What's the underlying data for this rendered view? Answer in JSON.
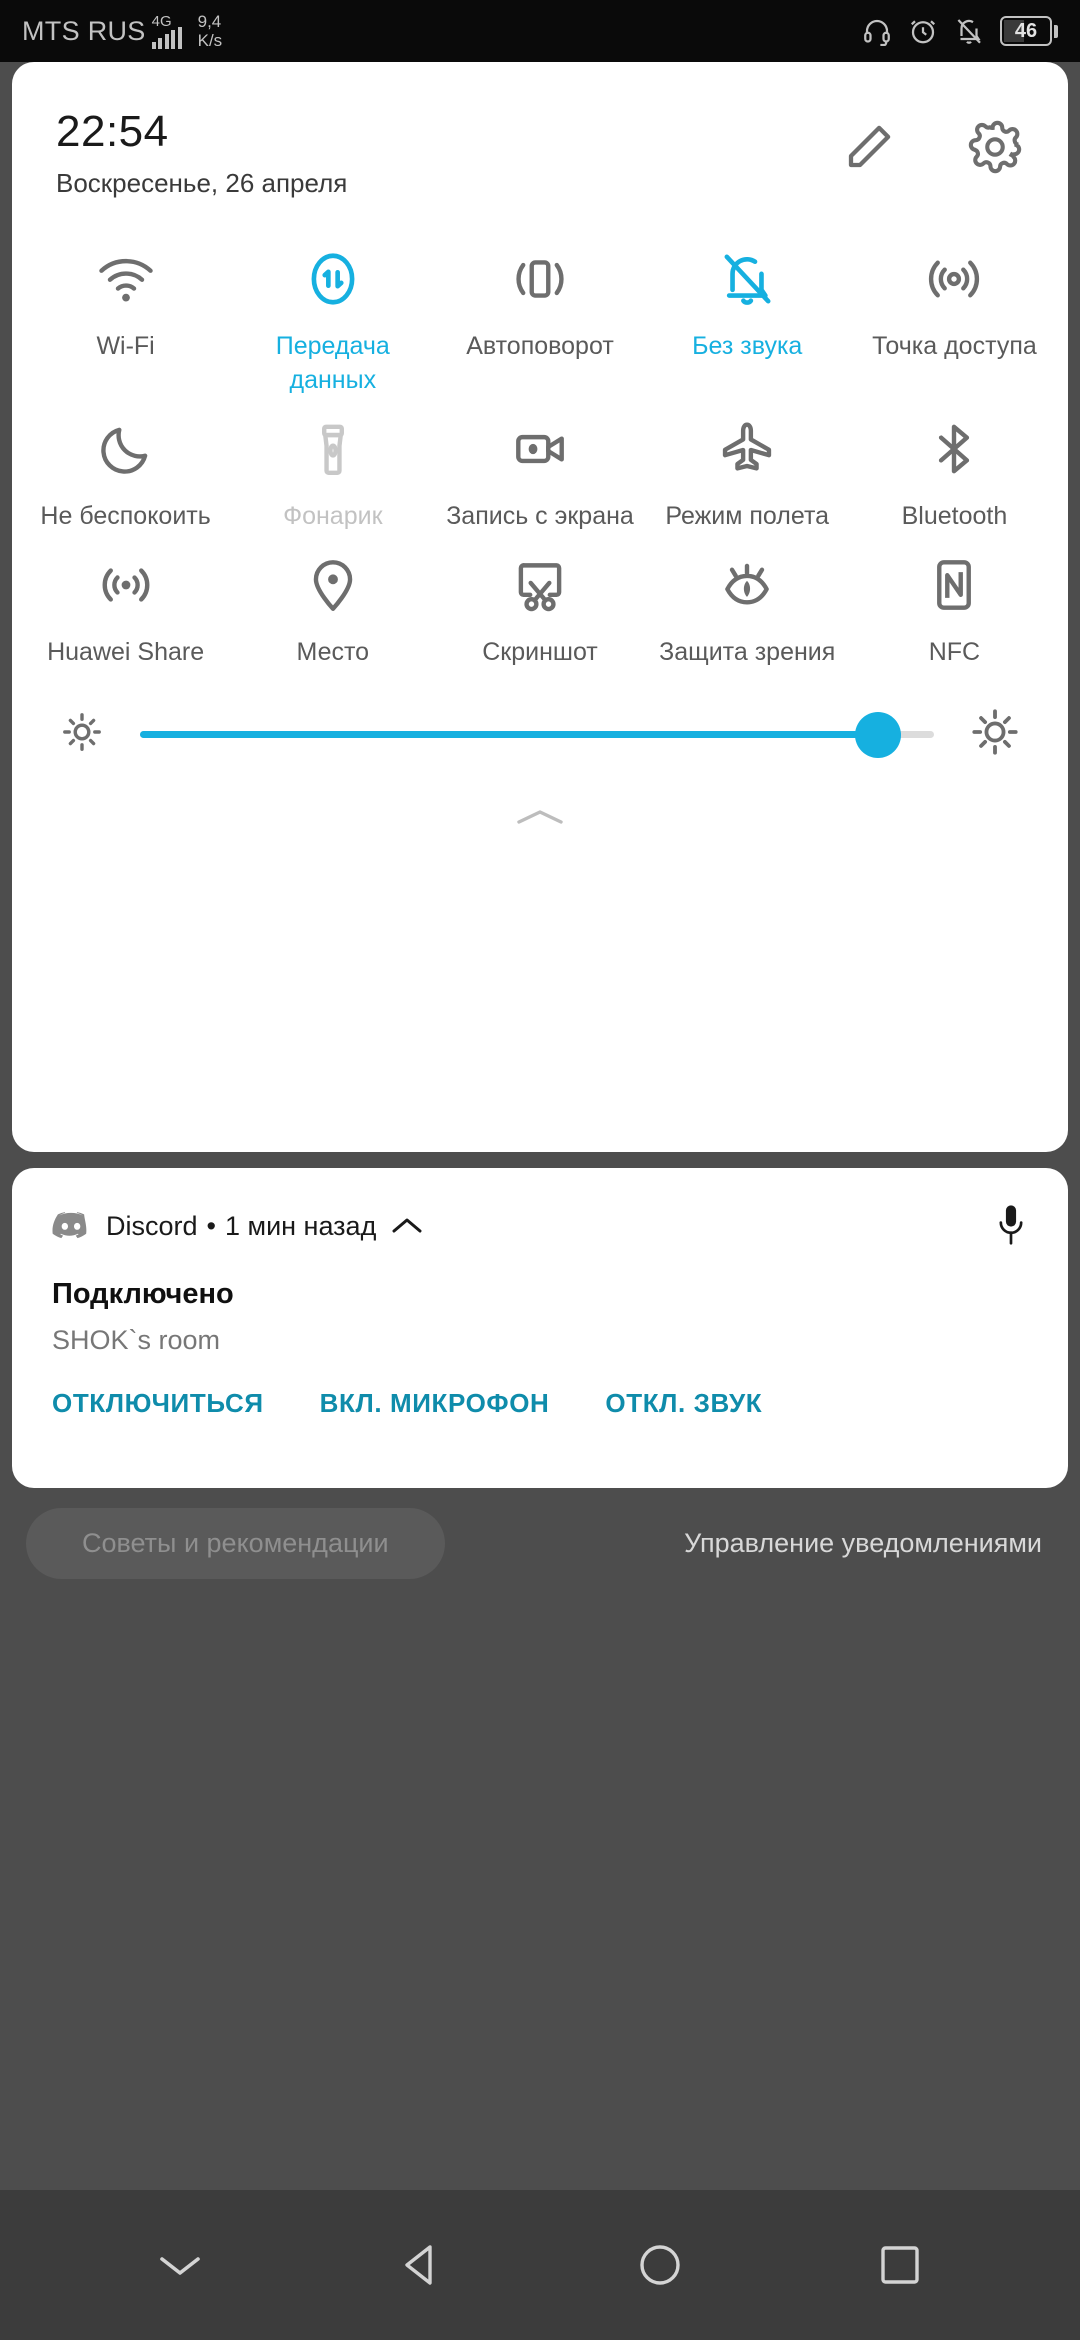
{
  "status_bar": {
    "carrier": "MTS RUS",
    "network_type": "4G",
    "signal_bars": 5,
    "data_speed_value": "9,4",
    "data_speed_unit": "K/s",
    "icons": [
      "headphones-icon",
      "alarm-icon",
      "bell-off-icon"
    ],
    "battery_percent": "46"
  },
  "quick_settings": {
    "clock": "22:54",
    "date": "Воскресенье, 26 апреля",
    "edit_icon": "pencil-icon",
    "settings_icon": "gear-icon",
    "accent_color": "#16b0e0",
    "inactive_color": "#5a5a5a",
    "disabled_color": "#c2c2c2",
    "tiles": [
      {
        "label": "Wi-Fi",
        "icon": "wifi-icon",
        "state": "off"
      },
      {
        "label": "Передача данных",
        "icon": "data-transfer-icon",
        "state": "on"
      },
      {
        "label": "Автоповорот",
        "icon": "auto-rotate-icon",
        "state": "off"
      },
      {
        "label": "Без звука",
        "icon": "bell-off-icon",
        "state": "on"
      },
      {
        "label": "Точка доступа",
        "icon": "hotspot-icon",
        "state": "off"
      },
      {
        "label": "Не беспокоить",
        "icon": "moon-icon",
        "state": "off"
      },
      {
        "label": "Фонарик",
        "icon": "flashlight-icon",
        "state": "disabled"
      },
      {
        "label": "Запись с экрана",
        "icon": "screen-record-icon",
        "state": "off"
      },
      {
        "label": "Режим полета",
        "icon": "airplane-icon",
        "state": "off"
      },
      {
        "label": "Bluetooth",
        "icon": "bluetooth-icon",
        "state": "off"
      },
      {
        "label": "Huawei Share",
        "icon": "huawei-share-icon",
        "state": "off"
      },
      {
        "label": "Место",
        "icon": "location-pin-icon",
        "state": "off"
      },
      {
        "label": "Скриншот",
        "icon": "scissors-icon",
        "state": "off"
      },
      {
        "label": "Защита зрения",
        "icon": "eye-comfort-icon",
        "state": "off"
      },
      {
        "label": "NFC",
        "icon": "nfc-icon",
        "state": "off"
      }
    ],
    "brightness": {
      "low_icon": "brightness-low-icon",
      "high_icon": "brightness-high-icon",
      "value_percent": 93
    },
    "expand_handle_icon": "chevron-up-icon"
  },
  "notification": {
    "app_icon": "discord-icon",
    "app_name": "Discord",
    "separator": "•",
    "time": "1 мин назад",
    "collapse_icon": "chevron-up-icon",
    "mic_icon": "microphone-icon",
    "title": "Подключено",
    "subtitle": "SHOK`s room",
    "actions": [
      {
        "label": "ОТКЛЮЧИТЬСЯ"
      },
      {
        "label": "ВКЛ. МИКРОФОН"
      },
      {
        "label": "ОТКЛ. ЗВУК"
      }
    ],
    "action_color": "#0f8cab"
  },
  "footer": {
    "tips_label": "Советы и рекомендации",
    "manage_label": "Управление уведомлениями"
  },
  "nav_bar": {
    "buttons": [
      {
        "icon": "chevron-down-icon",
        "name": "collapse-panel"
      },
      {
        "icon": "back-triangle-icon",
        "name": "back"
      },
      {
        "icon": "home-circle-icon",
        "name": "home"
      },
      {
        "icon": "recents-square-icon",
        "name": "recents"
      }
    ]
  }
}
